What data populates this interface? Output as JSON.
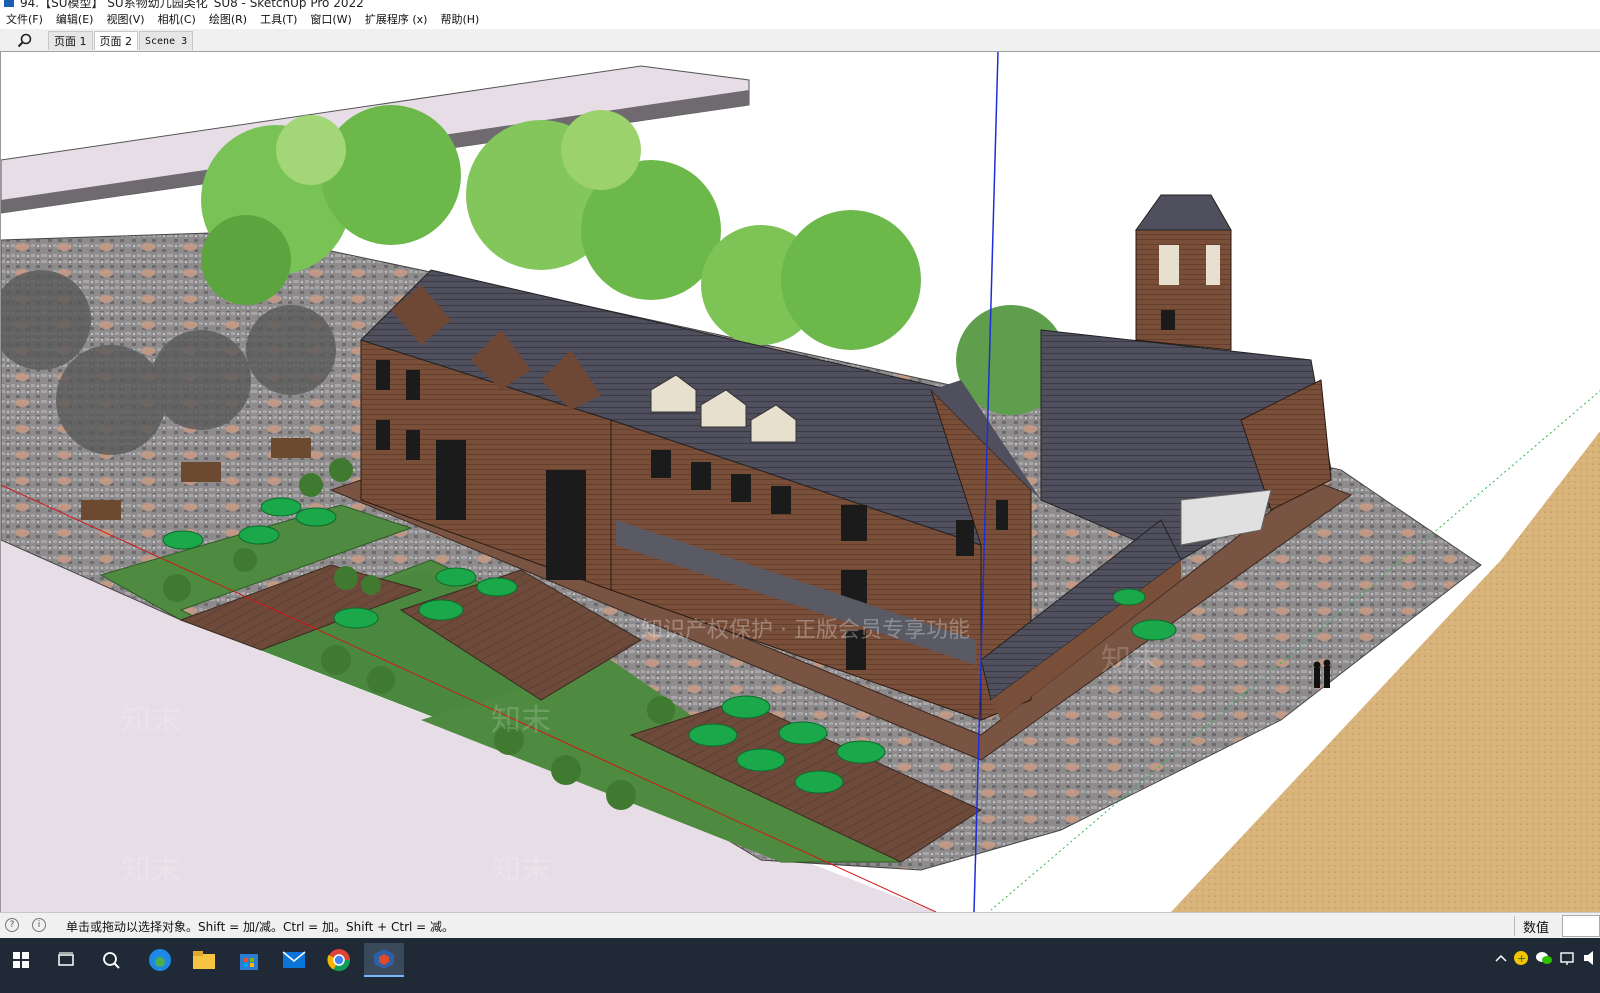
{
  "window": {
    "title": "94.【SU模型】 SU系物幼儿园类化_SU8 - SketchUp Pro 2022"
  },
  "menu": [
    "文件(F)",
    "编辑(E)",
    "视图(V)",
    "相机(C)",
    "绘图(R)",
    "工具(T)",
    "窗口(W)",
    "扩展程序 (x)",
    "帮助(H)"
  ],
  "scene_tabs": [
    "页面 1",
    "页面 2",
    "Scene 3"
  ],
  "active_tab_index": 1,
  "status": {
    "hint": "单击或拖动以选择对象。Shift = 加/减。Ctrl = 加。Shift + Ctrl = 减。",
    "measurements_label": "数值"
  },
  "viewport": {
    "watermark_text": "知末",
    "banner_text": "知识产权保护 · 正版会员专享功能",
    "colors": {
      "background": "#ffffff",
      "road": "#e6dde6",
      "paving": "#8e8b8d",
      "lawn": "#4e8a3f",
      "deck": "#6d4a3a",
      "brick": "#7a4f3a",
      "roof": "#4f4f5e",
      "umbrella": "#1aa84a",
      "sand": "#d8b37a",
      "tree": "#6db84a",
      "axis_blue": "#1f2dd6",
      "axis_red": "#d01818",
      "axis_green": "#2db84a"
    }
  },
  "taskbar": {
    "icons": [
      "windows-start-icon",
      "task-view-icon",
      "search-icon",
      "edge-icon",
      "file-explorer-icon",
      "store-icon",
      "mail-icon",
      "chrome-icon",
      "sketchup-icon"
    ],
    "active_icon": "sketchup-icon"
  }
}
